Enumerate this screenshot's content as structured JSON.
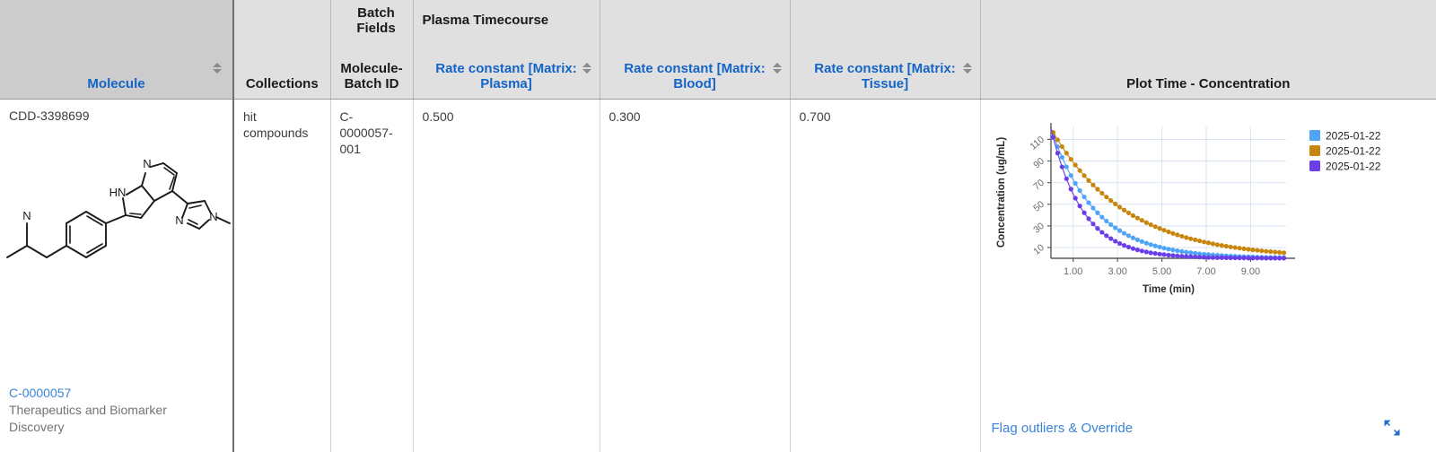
{
  "table": {
    "columns": [
      {
        "key": "molecule",
        "label": "Molecule",
        "style": "link",
        "sortable": true,
        "group": null
      },
      {
        "key": "collections",
        "label": "Collections",
        "style": "plain",
        "sortable": false,
        "group": null
      },
      {
        "key": "batchid",
        "label": "Molecule-Batch ID",
        "style": "plain",
        "sortable": false,
        "group": "Batch Fields"
      },
      {
        "key": "k_plasma",
        "label": "Rate constant [Matrix: Plasma]",
        "style": "link",
        "sortable": true,
        "group": "Plasma Timecourse"
      },
      {
        "key": "k_blood",
        "label": "Rate constant [Matrix: Blood]",
        "style": "link",
        "sortable": true,
        "group": null
      },
      {
        "key": "k_tissue",
        "label": "Rate constant [Matrix: Tissue]",
        "style": "link",
        "sortable": true,
        "group": null
      },
      {
        "key": "plot",
        "label": "Plot Time - Concentration",
        "style": "plain",
        "sortable": false,
        "group": null
      }
    ],
    "group_headers": {
      "plasma_timecourse": "Plasma Timecourse",
      "batch_fields": "Batch Fields"
    },
    "row": {
      "molecule_id": "CDD-3398699",
      "batch_link": "C-0000057",
      "project": "Therapeutics and Biomarker Discovery",
      "collections": "hit compounds",
      "batch_id": "C-0000057-001",
      "k_plasma": "0.500",
      "k_blood": "0.300",
      "k_tissue": "0.700"
    }
  },
  "plot_cell": {
    "flag_outliers_label": "Flag outliers & Override",
    "expand_icon": "expand-arrows-icon"
  },
  "structure": {
    "atom_labels": [
      "N",
      "HN",
      "N",
      "N",
      "N",
      "N"
    ],
    "name": "chemical-structure-diagram"
  },
  "chart_data": {
    "type": "line",
    "title": "",
    "xlabel": "Time (min)",
    "ylabel": "Concentration (ug/mL)",
    "xlim": [
      0,
      10.6
    ],
    "ylim": [
      0,
      122
    ],
    "xticks": [
      "1.00",
      "3.00",
      "5.00",
      "7.00",
      "9.00"
    ],
    "xtick_values": [
      1,
      3,
      5,
      7,
      9
    ],
    "yticks": [
      "10",
      "30",
      "50",
      "70",
      "90",
      "110"
    ],
    "ytick_values": [
      10,
      30,
      50,
      70,
      90,
      110
    ],
    "grid": true,
    "legend_position": "right",
    "marker": "circle",
    "series": [
      {
        "name": "2025-01-22",
        "color": "#4ea4f5",
        "matrix": "Plasma",
        "rate_constant": 0.5,
        "c0": 120,
        "x": [
          0.1,
          0.3,
          0.5,
          0.7,
          0.9,
          1.1,
          1.3,
          1.5,
          1.7,
          1.9,
          2.1,
          2.3,
          2.5,
          2.7,
          2.9,
          3.1,
          3.3,
          3.5,
          3.7,
          3.9,
          4.1,
          4.3,
          4.5,
          4.7,
          4.9,
          5.1,
          5.3,
          5.5,
          5.7,
          5.9,
          6.1,
          6.3,
          6.5,
          6.7,
          6.9,
          7.1,
          7.3,
          7.5,
          7.7,
          7.9,
          8.1,
          8.3,
          8.5,
          8.7,
          8.9,
          9.1,
          9.3,
          9.5,
          9.7,
          9.9,
          10.1,
          10.3,
          10.5
        ],
        "y": [
          114.1,
          103.3,
          93.5,
          84.6,
          76.6,
          69.3,
          62.7,
          56.8,
          51.4,
          46.5,
          42.1,
          38.1,
          34.5,
          31.2,
          28.2,
          25.6,
          23.1,
          20.9,
          18.9,
          17.1,
          15.5,
          14.0,
          12.7,
          11.5,
          10.4,
          9.4,
          8.5,
          7.7,
          7.0,
          6.3,
          5.7,
          5.2,
          4.7,
          4.2,
          3.8,
          3.5,
          3.1,
          2.8,
          2.6,
          2.3,
          2.1,
          1.9,
          1.7,
          1.5,
          1.4,
          1.3,
          1.1,
          1.0,
          0.9,
          0.9,
          0.8,
          0.7,
          0.6
        ]
      },
      {
        "name": "2025-01-22",
        "color": "#c8870c",
        "matrix": "Blood",
        "rate_constant": 0.3,
        "c0": 120,
        "x": [
          0.1,
          0.3,
          0.5,
          0.7,
          0.9,
          1.1,
          1.3,
          1.5,
          1.7,
          1.9,
          2.1,
          2.3,
          2.5,
          2.7,
          2.9,
          3.1,
          3.3,
          3.5,
          3.7,
          3.9,
          4.1,
          4.3,
          4.5,
          4.7,
          4.9,
          5.1,
          5.3,
          5.5,
          5.7,
          5.9,
          6.1,
          6.3,
          6.5,
          6.7,
          6.9,
          7.1,
          7.3,
          7.5,
          7.7,
          7.9,
          8.1,
          8.3,
          8.5,
          8.7,
          8.9,
          9.1,
          9.3,
          9.5,
          9.7,
          9.9,
          10.1,
          10.3,
          10.5
        ],
        "y": [
          116.5,
          109.7,
          103.3,
          97.3,
          91.6,
          86.3,
          81.2,
          76.5,
          72.0,
          67.8,
          63.9,
          60.2,
          56.7,
          53.4,
          50.3,
          47.3,
          44.6,
          42.0,
          39.5,
          37.2,
          35.1,
          33.0,
          31.1,
          29.3,
          27.6,
          26.0,
          24.5,
          23.0,
          21.7,
          20.4,
          19.2,
          18.1,
          17.1,
          16.1,
          15.1,
          14.3,
          13.4,
          12.6,
          11.9,
          11.2,
          10.5,
          9.9,
          9.4,
          8.8,
          8.3,
          7.8,
          7.4,
          6.9,
          6.5,
          6.2,
          5.8,
          5.5,
          5.1
        ]
      },
      {
        "name": "2025-01-22",
        "color": "#6b3fe8",
        "matrix": "Tissue",
        "rate_constant": 0.7,
        "c0": 120,
        "x": [
          0.1,
          0.3,
          0.5,
          0.7,
          0.9,
          1.1,
          1.3,
          1.5,
          1.7,
          1.9,
          2.1,
          2.3,
          2.5,
          2.7,
          2.9,
          3.1,
          3.3,
          3.5,
          3.7,
          3.9,
          4.1,
          4.3,
          4.5,
          4.7,
          4.9,
          5.1,
          5.3,
          5.5,
          5.7,
          5.9,
          6.1,
          6.3,
          6.5,
          6.7,
          6.9,
          7.1,
          7.3,
          7.5,
          7.7,
          7.9,
          8.1,
          8.3,
          8.5,
          8.7,
          8.9,
          9.1,
          9.3,
          9.5,
          9.7,
          9.9,
          10.1,
          10.3,
          10.5
        ],
        "y": [
          111.9,
          97.3,
          84.6,
          73.6,
          64.0,
          55.6,
          48.4,
          42.1,
          36.6,
          31.8,
          27.6,
          24.0,
          20.9,
          18.2,
          15.8,
          13.7,
          11.9,
          10.4,
          9.0,
          7.8,
          6.8,
          5.9,
          5.1,
          4.5,
          3.9,
          3.4,
          2.9,
          2.6,
          2.2,
          1.9,
          1.7,
          1.5,
          1.3,
          1.1,
          1.0,
          0.8,
          0.7,
          0.6,
          0.6,
          0.5,
          0.4,
          0.4,
          0.3,
          0.3,
          0.2,
          0.2,
          0.2,
          0.2,
          0.1,
          0.1,
          0.1,
          0.1,
          0.1
        ]
      }
    ]
  },
  "colors": {
    "link": "#3a84d8",
    "header_link": "#1464c8",
    "header_bg": "#e0e0e0",
    "frozen_header_bg": "#cccccc",
    "text": "#3c3c3c",
    "muted": "#737373"
  }
}
